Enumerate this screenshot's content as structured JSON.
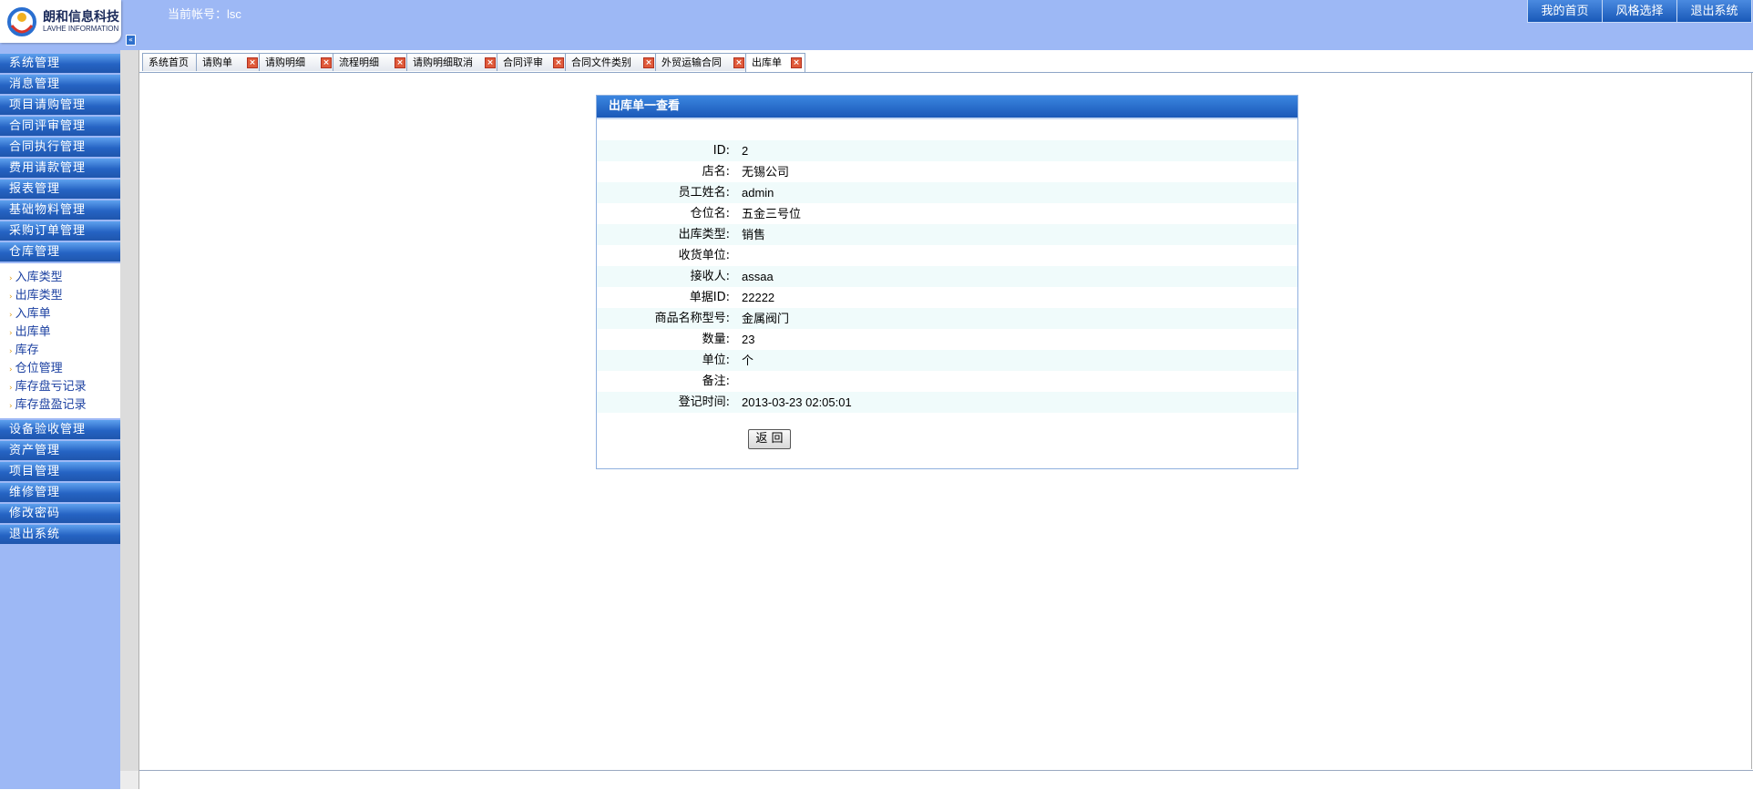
{
  "header": {
    "logo_cn": "朗和信息科技",
    "logo_en": "LAVHE INFORMATION",
    "account_label": "当前帐号：lsc",
    "buttons": [
      "我的首页",
      "风格选择",
      "退出系统"
    ]
  },
  "sidebar": {
    "menu_top": [
      "系统管理",
      "消息管理",
      "项目请购管理",
      "合同评审管理",
      "合同执行管理",
      "费用请款管理",
      "报表管理",
      "基础物料管理",
      "采购订单管理",
      "仓库管理"
    ],
    "submenu": [
      "入库类型",
      "出库类型",
      "入库单",
      "出库单",
      "库存",
      "仓位管理",
      "库存盘亏记录",
      "库存盘盈记录"
    ],
    "menu_bottom": [
      "设备验收管理",
      "资产管理",
      "项目管理",
      "维修管理",
      "修改密码",
      "退出系统"
    ]
  },
  "tabs": [
    "系统首页",
    "请购单",
    "请购明细",
    "流程明细",
    "请购明细取消",
    "合同评审",
    "合同文件类别",
    "外贸运输合同",
    "出库单"
  ],
  "panel": {
    "title": "出库单一查看",
    "fields": [
      {
        "label": "ID:",
        "value": "2"
      },
      {
        "label": "店名:",
        "value": "无锡公司"
      },
      {
        "label": "员工姓名:",
        "value": "admin"
      },
      {
        "label": "仓位名:",
        "value": "五金三号位"
      },
      {
        "label": "出库类型:",
        "value": "销售"
      },
      {
        "label": "收货单位:",
        "value": ""
      },
      {
        "label": "接收人:",
        "value": "assaa"
      },
      {
        "label": "单据ID:",
        "value": "22222"
      },
      {
        "label": "商品名称型号:",
        "value": "金属阀门"
      },
      {
        "label": "数量:",
        "value": "23"
      },
      {
        "label": "单位:",
        "value": "个"
      },
      {
        "label": "备注:",
        "value": ""
      },
      {
        "label": "登记时间:",
        "value": "2013-03-23 02:05:01"
      }
    ],
    "back_label": "返 回"
  },
  "colors": {
    "header_bg": "#9db8f5",
    "menu_blue": "#2563c3",
    "tab_close": "#e05a3a",
    "row_alt": "#f0fbfb"
  }
}
